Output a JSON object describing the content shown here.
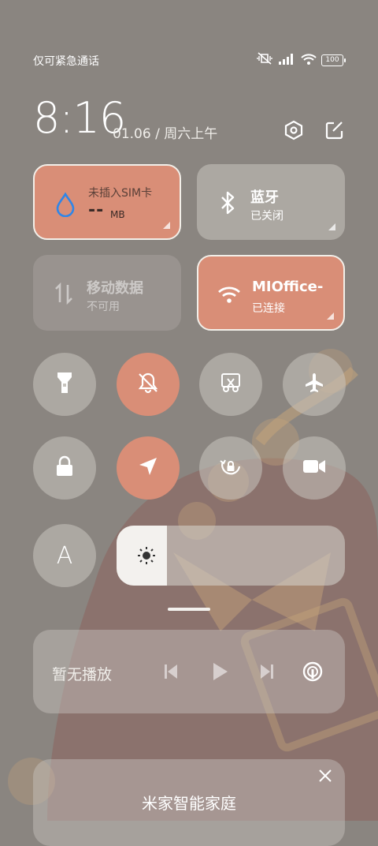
{
  "status": {
    "carrier_text": "仅可紧急通话",
    "battery": "100"
  },
  "header": {
    "time": "8:16",
    "date": "01.06 / 周六上午"
  },
  "tiles": {
    "sim": {
      "title": "未插入SIM卡",
      "value": "--",
      "unit": "MB"
    },
    "bluetooth": {
      "title": "蓝牙",
      "sub": "已关闭"
    },
    "mobile_data": {
      "title": "移动数据",
      "sub": "不可用"
    },
    "wifi": {
      "title": "MIOffice-",
      "sub": "已连接"
    }
  },
  "toggles": [
    {
      "icon": "flashlight-icon",
      "state": "off"
    },
    {
      "icon": "mute-icon",
      "state": "on"
    },
    {
      "icon": "screenshot-icon",
      "state": "off"
    },
    {
      "icon": "airplane-icon",
      "state": "off"
    },
    {
      "icon": "lock-icon",
      "state": "off"
    },
    {
      "icon": "location-icon",
      "state": "on"
    },
    {
      "icon": "rotation-lock-icon",
      "state": "off"
    },
    {
      "icon": "screen-record-icon",
      "state": "off"
    }
  ],
  "auto_brightness": {
    "label": "A"
  },
  "brightness": {
    "level": 0.22
  },
  "media": {
    "label": "暂无播放"
  },
  "smart_home": {
    "title": "米家智能家庭"
  },
  "colors": {
    "accent": "#d98e77",
    "tile": "#c8c4be",
    "background": "#8a8580"
  }
}
